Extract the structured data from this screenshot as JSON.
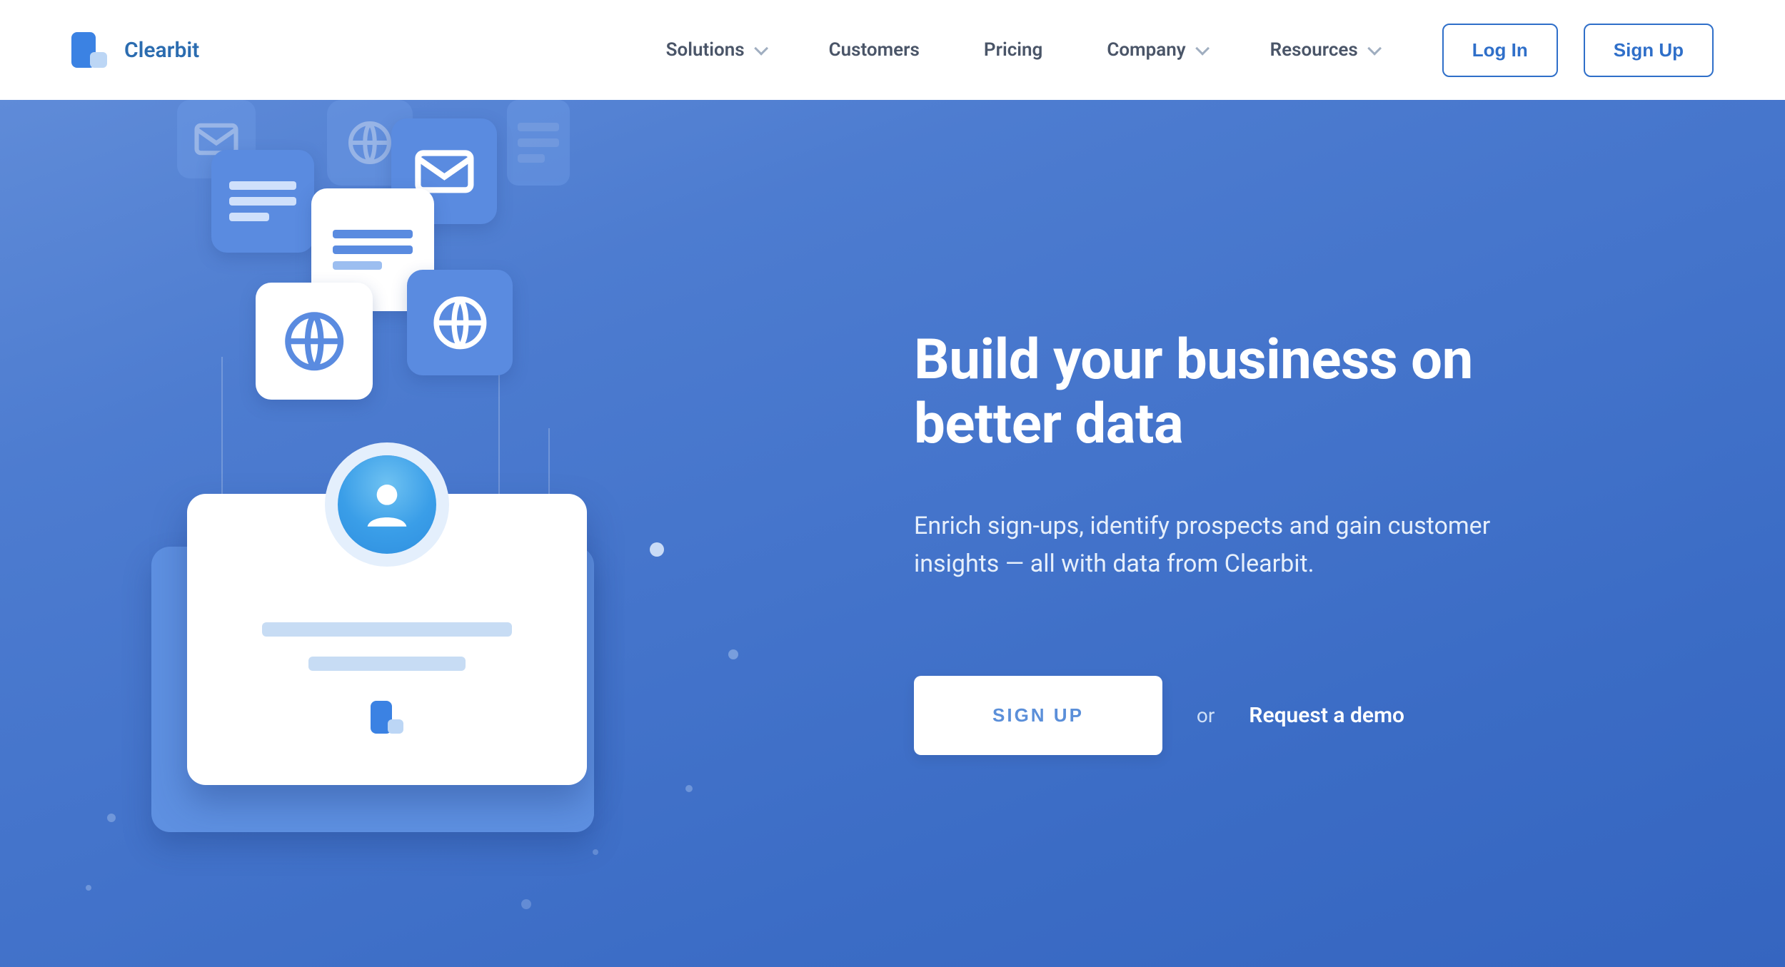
{
  "brand": {
    "name": "Clearbit"
  },
  "nav": {
    "links": [
      {
        "label": "Solutions",
        "dropdown": true
      },
      {
        "label": "Customers",
        "dropdown": false
      },
      {
        "label": "Pricing",
        "dropdown": false
      },
      {
        "label": "Company",
        "dropdown": true
      },
      {
        "label": "Resources",
        "dropdown": true
      }
    ],
    "actions": {
      "login": "Log In",
      "signup": "Sign Up"
    }
  },
  "hero": {
    "title_line1": "Build your business on",
    "title_line2": "better data",
    "subtitle": "Enrich sign-ups, identify prospects and gain customer insights — all with data from Clearbit.",
    "cta_primary": "SIGN UP",
    "cta_or": "or",
    "cta_demo": "Request a demo"
  },
  "colors": {
    "brand_blue": "#3b82e3",
    "brand_blue_light": "#bcd6f5",
    "nav_text": "#4a5568",
    "outline_btn": "#2f6fc9",
    "hero_grad_from": "#5f8bd8",
    "hero_grad_to": "#3565c0"
  },
  "icons": {
    "envelope": "envelope-icon",
    "globe": "globe-icon",
    "document": "document-icon",
    "avatar": "person-icon",
    "chevron_down": "chevron-down-icon",
    "logo": "clearbit-logo-icon"
  }
}
